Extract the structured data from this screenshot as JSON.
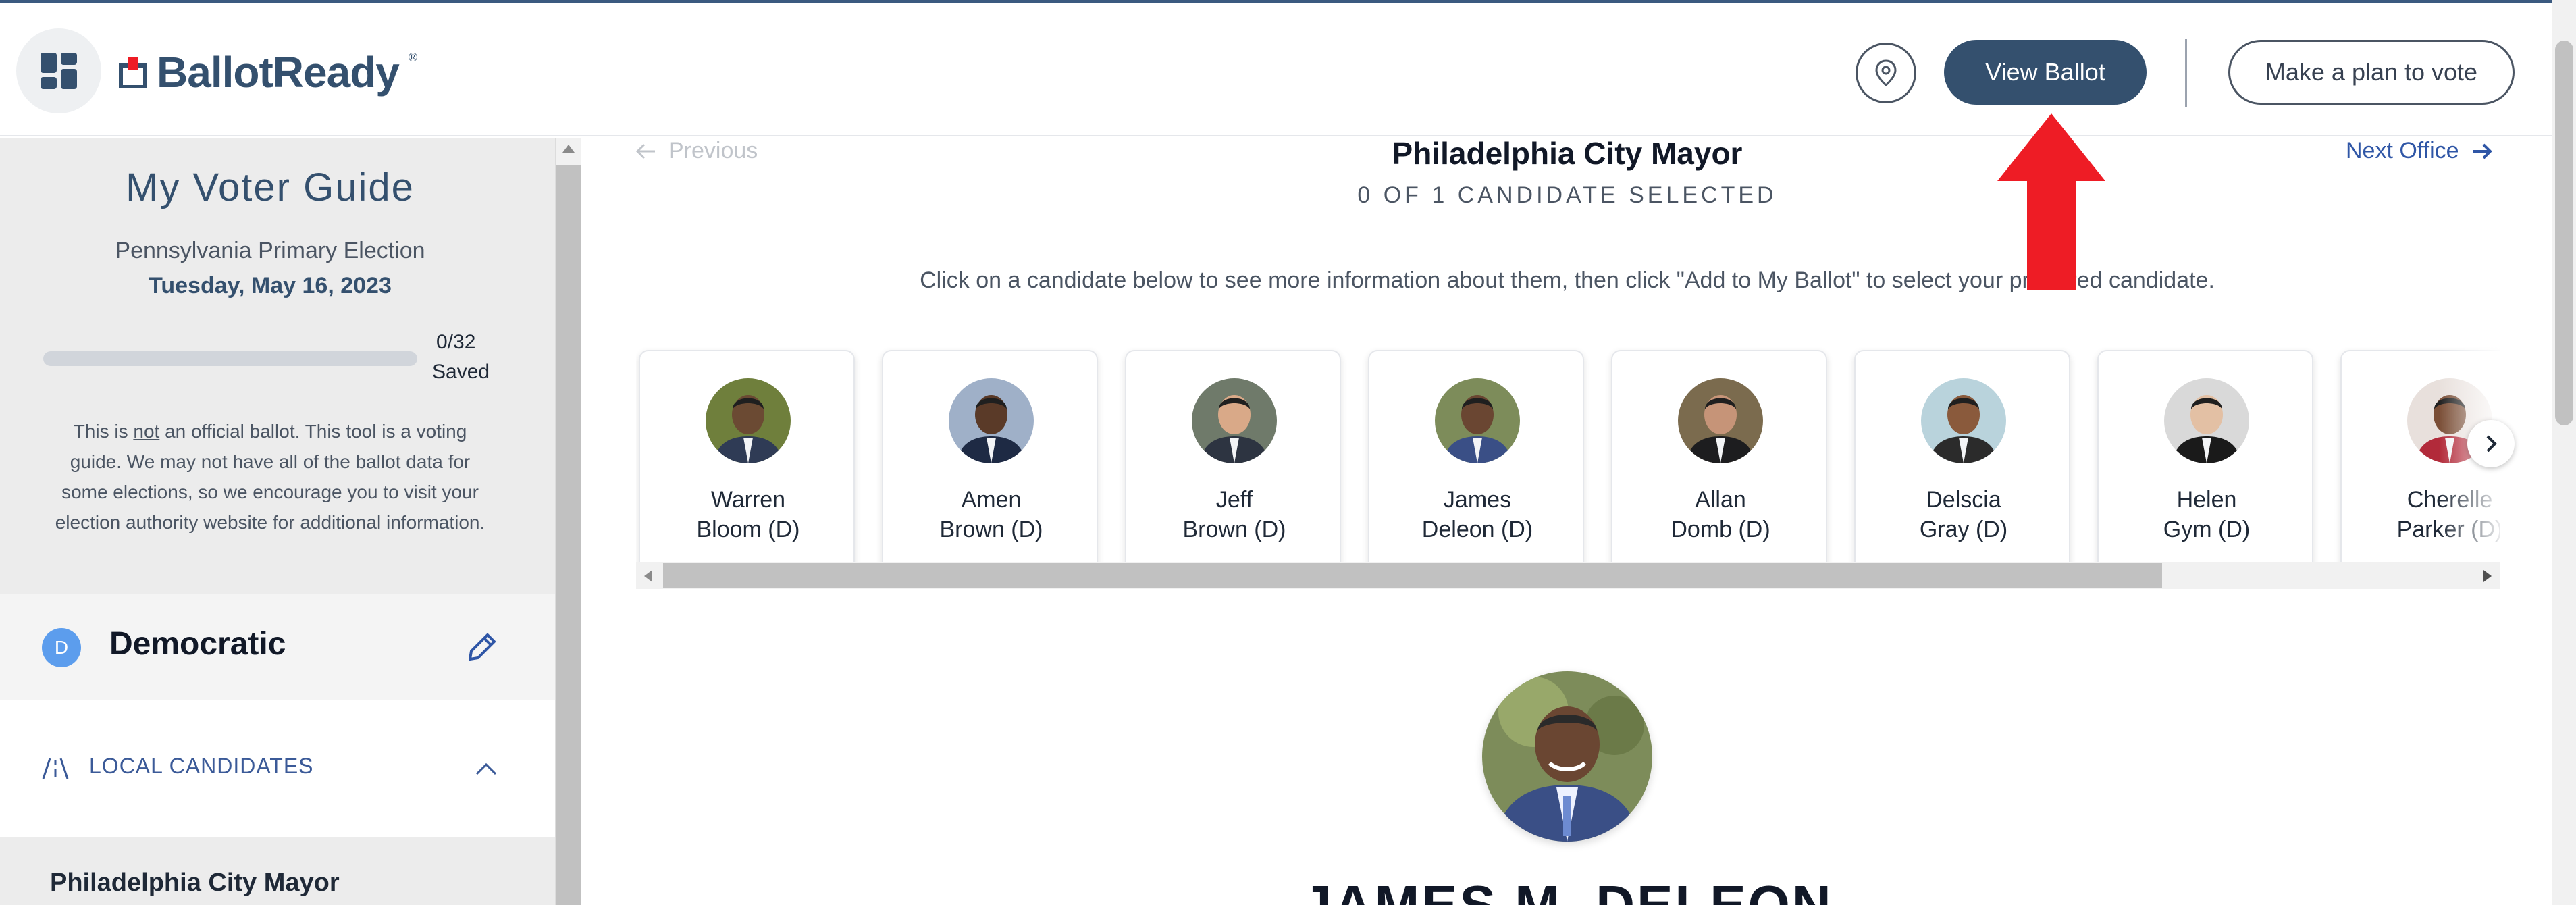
{
  "header": {
    "logo_text": "BallotReady",
    "logo_reg": "®",
    "view_ballot_label": "View Ballot",
    "plan_label": "Make a plan to vote"
  },
  "sidebar": {
    "title": "My Voter Guide",
    "election_name": "Pennsylvania Primary Election",
    "election_date": "Tuesday, May 16, 2023",
    "progress": {
      "saved": 0,
      "total": 32,
      "count_text": "0/32",
      "saved_label": "Saved"
    },
    "disclaimer_pre": "This is ",
    "disclaimer_em": "not",
    "disclaimer_post": " an official ballot. This tool is a voting guide. We may not have all of the ballot data for some elections, so we encourage you to visit your election authority website for additional information.",
    "party": {
      "badge": "D",
      "name": "Democratic"
    },
    "section_label": "LOCAL CANDIDATES",
    "office_item": "Philadelphia City Mayor"
  },
  "main": {
    "prev_label": "Previous",
    "next_label": "Next Office",
    "office_title": "Philadelphia City Mayor",
    "selected_count": "0 OF 1 CANDIDATE SELECTED",
    "instructions": "Click on a candidate below to see more information about them, then click \"Add to My Ballot\" to select your preferred candidate.",
    "candidates": [
      {
        "first": "Warren",
        "last": "Bloom (D)",
        "skin": "#6b4a33",
        "bg": "#6f7f3c",
        "suit": "#2f3b55"
      },
      {
        "first": "Amen",
        "last": "Brown (D)",
        "skin": "#5a3a28",
        "bg": "#9fb0c8",
        "suit": "#1e2a44"
      },
      {
        "first": "Jeff",
        "last": "Brown (D)",
        "skin": "#d9a988",
        "bg": "#6f7a6a",
        "suit": "#2d3441"
      },
      {
        "first": "James",
        "last": "Deleon (D)",
        "skin": "#6a4632",
        "bg": "#7d8c5a",
        "suit": "#3a4f86"
      },
      {
        "first": "Allan",
        "last": "Domb (D)",
        "skin": "#c69478",
        "bg": "#7b6b4e",
        "suit": "#1d1d1f"
      },
      {
        "first": "Delscia",
        "last": "Gray (D)",
        "skin": "#8a5a3c",
        "bg": "#b9d3dc",
        "suit": "#2b2b2b"
      },
      {
        "first": "Helen",
        "last": "Gym (D)",
        "skin": "#e3c0a4",
        "bg": "#d9d9d9",
        "suit": "#1a1a1a"
      },
      {
        "first": "Cherelle",
        "last": "Parker (D)",
        "skin": "#7a4e36",
        "bg": "#e8e0dc",
        "suit": "#b22a3a"
      }
    ],
    "candidate_heading": "JAMES M. DELEON"
  },
  "colors": {
    "brand": "#34506e",
    "link": "#2f56a6",
    "party_badge": "#5c9ded",
    "annotation_arrow": "#ee1c25"
  },
  "icons": {
    "app_switch": "grid-icon",
    "location": "map-pin-icon",
    "edit": "pencil-icon",
    "section": "road-icon",
    "collapse": "chevron-up-icon",
    "prev": "arrow-left-icon",
    "next": "arrow-right-icon",
    "carousel_next": "chevron-right-icon"
  }
}
